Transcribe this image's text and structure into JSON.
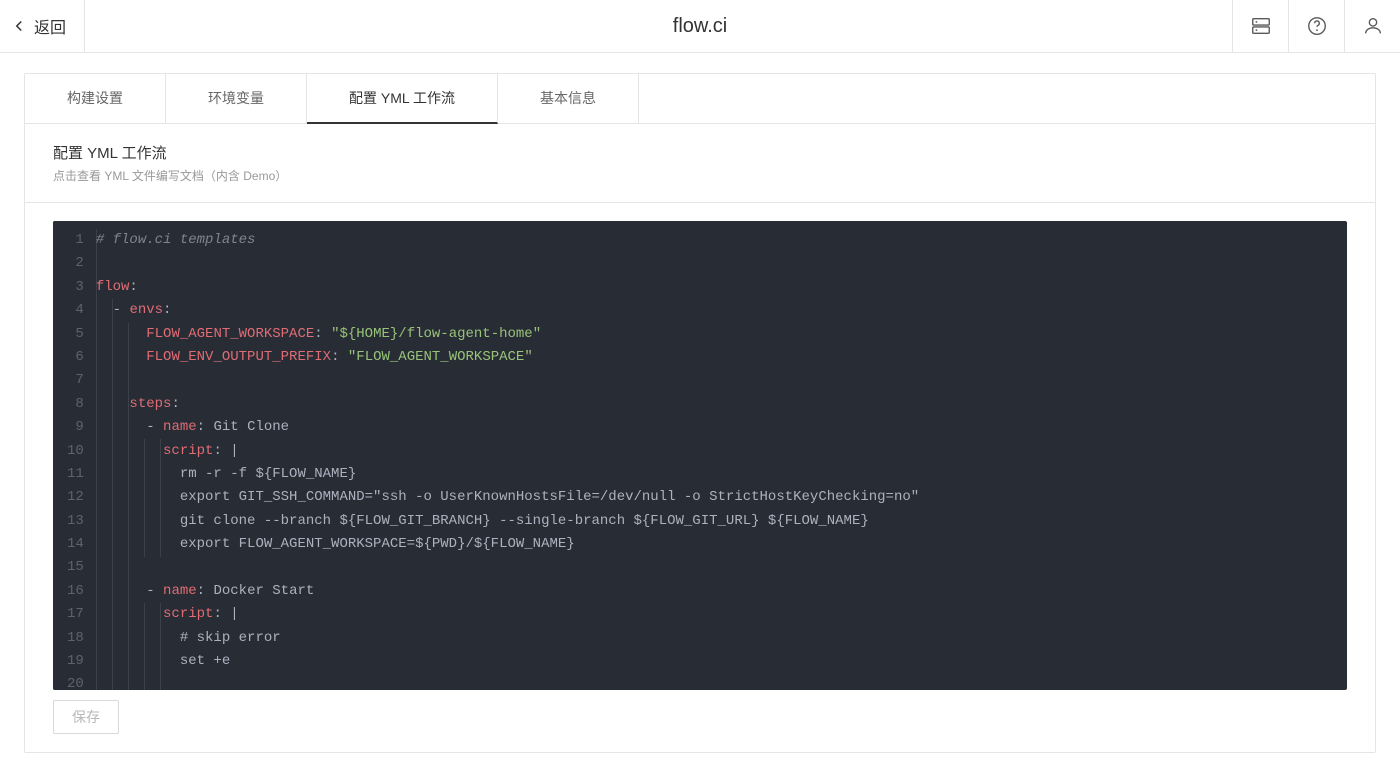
{
  "topbar": {
    "back_label": "返回",
    "logo": "flow.ci"
  },
  "tabs": [
    {
      "label": "构建设置"
    },
    {
      "label": "环境变量"
    },
    {
      "label": "配置 YML 工作流"
    },
    {
      "label": "基本信息"
    }
  ],
  "section": {
    "title": "配置 YML 工作流",
    "subtitle": "点击查看 YML 文件编写文档（内含 Demo）"
  },
  "editor": {
    "line_count": 20,
    "lines": {
      "l1_comment": "# flow.ci templates",
      "l3_key": "flow",
      "l4_dash": "- ",
      "l4_key": "envs",
      "l5_key": "FLOW_AGENT_WORKSPACE",
      "l5_val": "\"${HOME}/flow-agent-home\"",
      "l6_key": "FLOW_ENV_OUTPUT_PREFIX",
      "l6_val": "\"FLOW_AGENT_WORKSPACE\"",
      "l8_key": "steps",
      "l9_dash": "- ",
      "l9_key": "name",
      "l9_val": "Git Clone",
      "l10_key": "script",
      "l10_val": "|",
      "l11": "rm -r -f ${FLOW_NAME}",
      "l12": "export GIT_SSH_COMMAND=\"ssh -o UserKnownHostsFile=/dev/null -o StrictHostKeyChecking=no\"",
      "l13": "git clone --branch ${FLOW_GIT_BRANCH} --single-branch ${FLOW_GIT_URL} ${FLOW_NAME}",
      "l14": "export FLOW_AGENT_WORKSPACE=${PWD}/${FLOW_NAME}",
      "l16_dash": "- ",
      "l16_key": "name",
      "l16_val": "Docker Start",
      "l17_key": "script",
      "l17_val": "|",
      "l18": "# skip error",
      "l19": "set +e"
    }
  },
  "buttons": {
    "save": "保存"
  }
}
